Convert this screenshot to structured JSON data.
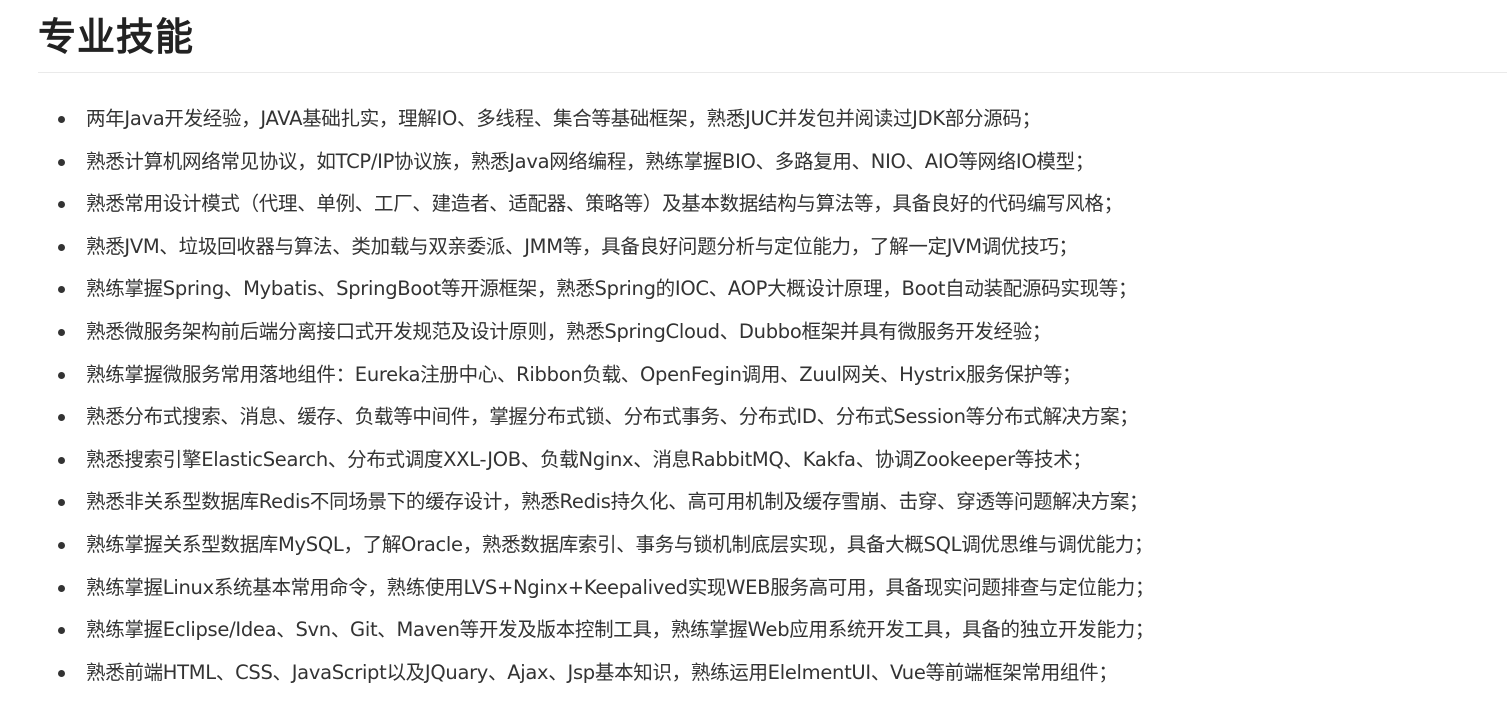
{
  "section": {
    "title": "专业技能"
  },
  "skills": [
    "两年Java开发经验，JAVA基础扎实，理解IO、多线程、集合等基础框架，熟悉JUC并发包并阅读过JDK部分源码；",
    "熟悉计算机网络常见协议，如TCP/IP协议族，熟悉Java网络编程，熟练掌握BIO、多路复用、NIO、AIO等网络IO模型；",
    "熟悉常用设计模式（代理、单例、工厂、建造者、适配器、策略等）及基本数据结构与算法等，具备良好的代码编写风格；",
    "熟悉JVM、垃圾回收器与算法、类加载与双亲委派、JMM等，具备良好问题分析与定位能力，了解一定JVM调优技巧；",
    "熟练掌握Spring、Mybatis、SpringBoot等开源框架，熟悉Spring的IOC、AOP大概设计原理，Boot自动装配源码实现等；",
    "熟悉微服务架构前后端分离接口式开发规范及设计原则，熟悉SpringCloud、Dubbo框架并具有微服务开发经验；",
    "熟练掌握微服务常用落地组件：Eureka注册中心、Ribbon负载、OpenFegin调用、Zuul网关、Hystrix服务保护等；",
    "熟悉分布式搜索、消息、缓存、负载等中间件，掌握分布式锁、分布式事务、分布式ID、分布式Session等分布式解决方案；",
    "熟悉搜索引擎ElasticSearch、分布式调度XXL-JOB、负载Nginx、消息RabbitMQ、Kakfa、协调Zookeeper等技术；",
    "熟悉非关系型数据库Redis不同场景下的缓存设计，熟悉Redis持久化、高可用机制及缓存雪崩、击穿、穿透等问题解决方案；",
    "熟练掌握关系型数据库MySQL，了解Oracle，熟悉数据库索引、事务与锁机制底层实现，具备大概SQL调优思维与调优能力；",
    "熟练掌握Linux系统基本常用命令，熟练使用LVS+Nginx+Keepalived实现WEB服务高可用，具备现实问题排查与定位能力；",
    "熟练掌握Eclipse/Idea、Svn、Git、Maven等开发及版本控制工具，熟练掌握Web应用系统开发工具，具备的独立开发能力；",
    "熟悉前端HTML、CSS、JavaScript以及JQuary、Ajax、Jsp基本知识，熟练运用ElelmentUI、Vue等前端框架常用组件；"
  ]
}
